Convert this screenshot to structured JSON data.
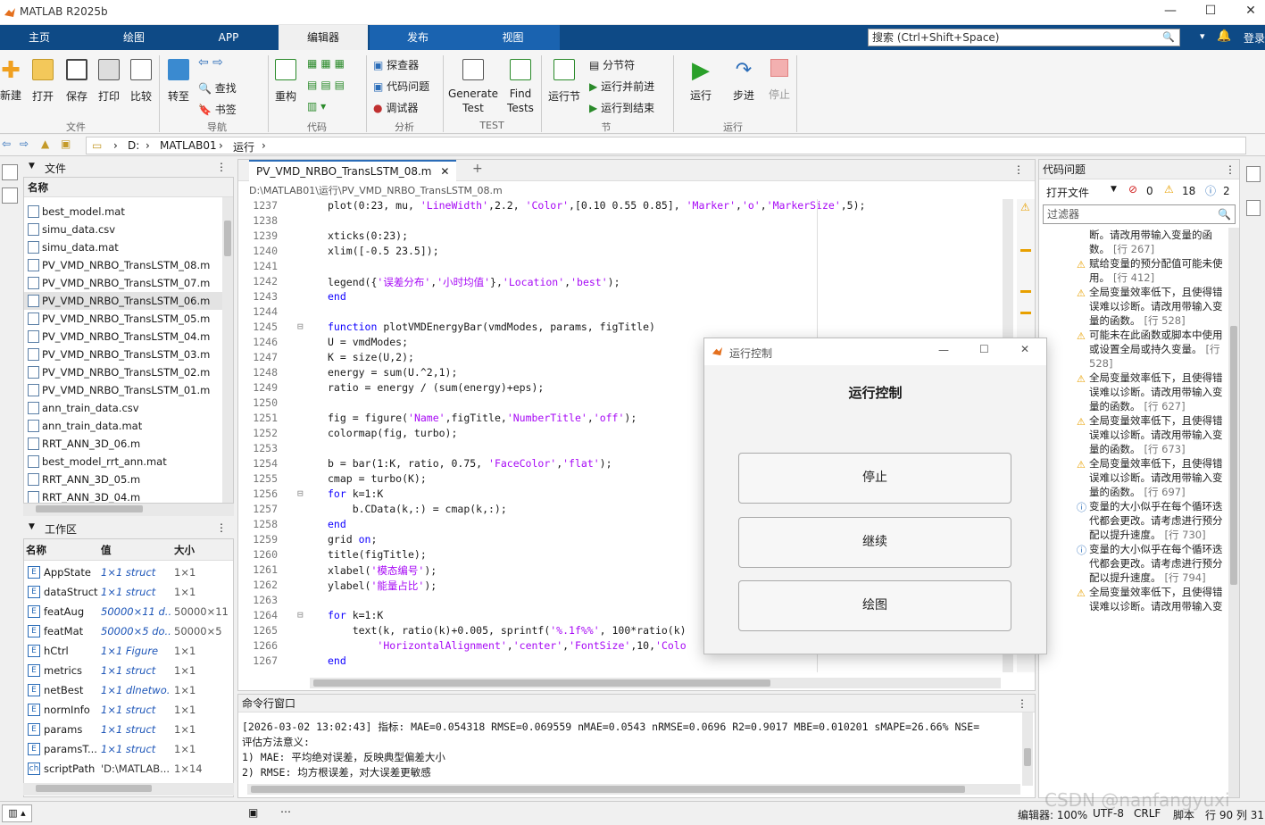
{
  "window": {
    "title": "MATLAB R2025b"
  },
  "tabs": [
    "主页",
    "绘图",
    "APP",
    "编辑器",
    "发布",
    "视图"
  ],
  "search": {
    "placeholder": "搜索 (Ctrl+Shift+Space)"
  },
  "login": "登录",
  "ribbon": {
    "file": {
      "new": "新建",
      "open": "打开",
      "save": "保存",
      "print": "打印",
      "compare": "比较",
      "group": "文件"
    },
    "nav": {
      "goto": "转至",
      "find": "查找",
      "bookmark": "书签",
      "group": "导航"
    },
    "code": {
      "refactor": "重构",
      "group": "代码"
    },
    "analysis": {
      "profiler": "探查器",
      "issues": "代码问题",
      "debugger": "调试器",
      "group": "分析"
    },
    "test": {
      "generate": "Generate Test",
      "find": "Find Tests",
      "group": "TEST"
    },
    "section": {
      "run_section": "运行节",
      "divider": "分节符",
      "run_advance": "运行并前进",
      "run_to_end": "运行到结束",
      "group": "节"
    },
    "run": {
      "run": "运行",
      "step": "步进",
      "stop": "停止",
      "group": "运行"
    }
  },
  "address": {
    "drive": "D:",
    "folder1": "MATLAB01",
    "folder2": "运行"
  },
  "files_panel": {
    "title": "文件",
    "header": "名称",
    "items": [
      "best_model.mat",
      "simu_data.csv",
      "simu_data.mat",
      "PV_VMD_NRBO_TransLSTM_08.m",
      "PV_VMD_NRBO_TransLSTM_07.m",
      "PV_VMD_NRBO_TransLSTM_06.m",
      "PV_VMD_NRBO_TransLSTM_05.m",
      "PV_VMD_NRBO_TransLSTM_04.m",
      "PV_VMD_NRBO_TransLSTM_03.m",
      "PV_VMD_NRBO_TransLSTM_02.m",
      "PV_VMD_NRBO_TransLSTM_01.m",
      "ann_train_data.csv",
      "ann_train_data.mat",
      "RRT_ANN_3D_06.m",
      "best_model_rrt_ann.mat",
      "RRT_ANN_3D_05.m",
      "RRT_ANN_3D_04.m"
    ]
  },
  "workspace": {
    "title": "工作区",
    "col_name": "名称",
    "col_value": "值",
    "col_size": "大小",
    "rows": [
      {
        "name": "AppState",
        "value": "1×1 struct",
        "size": "1×1"
      },
      {
        "name": "dataStruct",
        "value": "1×1 struct",
        "size": "1×1"
      },
      {
        "name": "featAug",
        "value": "50000×11 d...",
        "size": "50000×11"
      },
      {
        "name": "featMat",
        "value": "50000×5 do...",
        "size": "50000×5"
      },
      {
        "name": "hCtrl",
        "value": "1×1 Figure",
        "size": "1×1"
      },
      {
        "name": "metrics",
        "value": "1×1 struct",
        "size": "1×1"
      },
      {
        "name": "netBest",
        "value": "1×1 dlnetwo...",
        "size": "1×1"
      },
      {
        "name": "normInfo",
        "value": "1×1 struct",
        "size": "1×1"
      },
      {
        "name": "params",
        "value": "1×1 struct",
        "size": "1×1"
      },
      {
        "name": "paramsT...",
        "value": "1×1 struct",
        "size": "1×1"
      },
      {
        "name": "scriptPath",
        "value": "'D:\\MATLAB...",
        "size": "1×14"
      }
    ]
  },
  "editor": {
    "tab": "PV_VMD_NRBO_TransLSTM_08.m",
    "path": "D:\\MATLAB01\\运行\\PV_VMD_NRBO_TransLSTM_08.m",
    "lines": [
      {
        "n": "1237",
        "t": "plot(0:23, mu, 'LineWidth',2.2, 'Color',[0.10 0.55 0.85], 'Marker','o','MarkerSize',5);"
      },
      {
        "n": "1238",
        "t": ""
      },
      {
        "n": "1239",
        "t": "xticks(0:23);"
      },
      {
        "n": "1240",
        "t": "xlim([-0.5 23.5]);"
      },
      {
        "n": "1241",
        "t": ""
      },
      {
        "n": "1242",
        "t": "legend({'误差分布','小时均值'},'Location','best');"
      },
      {
        "n": "1243",
        "t": "end"
      },
      {
        "n": "1244",
        "t": ""
      },
      {
        "n": "1245",
        "t": "function plotVMDEnergyBar(vmdModes, params, figTitle)"
      },
      {
        "n": "1246",
        "t": "U = vmdModes;"
      },
      {
        "n": "1247",
        "t": "K = size(U,2);"
      },
      {
        "n": "1248",
        "t": "energy = sum(U.^2,1);"
      },
      {
        "n": "1249",
        "t": "ratio = energy / (sum(energy)+eps);"
      },
      {
        "n": "1250",
        "t": ""
      },
      {
        "n": "1251",
        "t": "fig = figure('Name',figTitle,'NumberTitle','off');"
      },
      {
        "n": "1252",
        "t": "colormap(fig, turbo);"
      },
      {
        "n": "1253",
        "t": ""
      },
      {
        "n": "1254",
        "t": "b = bar(1:K, ratio, 0.75, 'FaceColor','flat');"
      },
      {
        "n": "1255",
        "t": "cmap = turbo(K);"
      },
      {
        "n": "1256",
        "t": "for k=1:K"
      },
      {
        "n": "1257",
        "t": "    b.CData(k,:) = cmap(k,:);"
      },
      {
        "n": "1258",
        "t": "end"
      },
      {
        "n": "1259",
        "t": "grid on;"
      },
      {
        "n": "1260",
        "t": "title(figTitle);"
      },
      {
        "n": "1261",
        "t": "xlabel('模态编号');"
      },
      {
        "n": "1262",
        "t": "ylabel('能量占比');"
      },
      {
        "n": "1263",
        "t": ""
      },
      {
        "n": "1264",
        "t": "for k=1:K"
      },
      {
        "n": "1265",
        "t": "    text(k, ratio(k)+0.005, sprintf('%.1f%%', 100*ratio(k)"
      },
      {
        "n": "1266",
        "t": "        'HorizontalAlignment','center','FontSize',10,'Colo"
      },
      {
        "n": "1267",
        "t": "end"
      },
      {
        "n": "1268",
        "t": "end"
      }
    ]
  },
  "cmd": {
    "title": "命令行窗口",
    "lines": [
      "[2026-03-02 13:02:43] 指标: MAE=0.054318 RMSE=0.069559 nMAE=0.0543 nRMSE=0.0696 R2=0.9017 MBE=0.010201 sMAPE=26.66% NSE=",
      "评估方法意义:",
      "1) MAE: 平均绝对误差，反映典型偏差大小",
      "2) RMSE: 均方根误差，对大误差更敏感"
    ]
  },
  "issues": {
    "title": "代码问题",
    "scope": "打开文件",
    "errors": "0",
    "warnings": "18",
    "infos": "2",
    "filter_placeholder": "过滤器",
    "items": [
      {
        "type": "partial",
        "text": "断。请改用带输入变量的函数。",
        "line": "[行 267]"
      },
      {
        "type": "warn",
        "text": "赋给变量的预分配值可能未使用。",
        "line": "[行 412]"
      },
      {
        "type": "warn",
        "text": "全局变量效率低下，且使得错误难以诊断。请改用带输入变量的函数。",
        "line": "[行 528]"
      },
      {
        "type": "warn",
        "text": "可能未在此函数或脚本中使用或设置全局或持久变量。",
        "line": "[行 528]"
      },
      {
        "type": "warn",
        "text": "全局变量效率低下，且使得错误难以诊断。请改用带输入变量的函数。",
        "line": "[行 627]"
      },
      {
        "type": "warn",
        "text": "全局变量效率低下，且使得错误难以诊断。请改用带输入变量的函数。",
        "line": "[行 673]"
      },
      {
        "type": "warn",
        "text": "全局变量效率低下，且使得错误难以诊断。请改用带输入变量的函数。",
        "line": "[行 697]"
      },
      {
        "type": "info",
        "text": "变量的大小似乎在每个循环迭代都会更改。请考虑进行预分配以提升速度。",
        "line": "[行 730]"
      },
      {
        "type": "info",
        "text": "变量的大小似乎在每个循环迭代都会更改。请考虑进行预分配以提升速度。",
        "line": "[行 794]"
      },
      {
        "type": "warn",
        "text": "全局变量效率低下，且使得错误难以诊断。请改用带输入变",
        "line": ""
      }
    ]
  },
  "dialog": {
    "window_title": "运行控制",
    "heading": "运行控制",
    "btn_stop": "停止",
    "btn_continue": "继续",
    "btn_plot": "绘图"
  },
  "status": {
    "editor": "编辑器: 100%",
    "encoding": "UTF-8",
    "eol": "CRLF",
    "type": "脚本",
    "pos": "行 90 列 31",
    "watermark": "CSDN @nanfangyuxi"
  }
}
